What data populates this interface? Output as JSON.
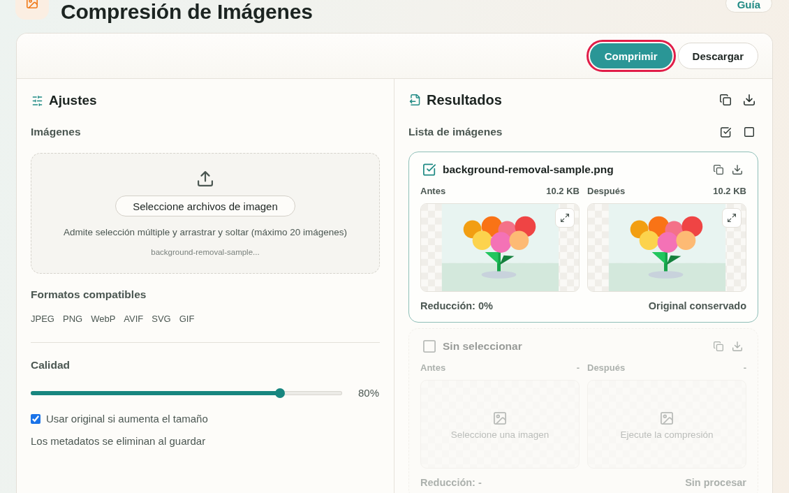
{
  "header": {
    "title": "Compresión de Imágenes",
    "guide_button": "Guía"
  },
  "toolbar": {
    "buttons": [
      {
        "label": "Comprimir",
        "kind": "primary",
        "focused": true
      },
      {
        "label": "Descargar",
        "kind": "secondary",
        "focused": false
      }
    ]
  },
  "settings": {
    "title": "Ajustes",
    "images_label": "Imágenes",
    "dropzone": {
      "button": "Seleccione archivos de imagen",
      "hint": "Admite selección múltiple y arrastrar y soltar (máximo 20 imágenes)",
      "file": "background-removal-sample..."
    },
    "formats_label": "Formatos compatibles",
    "formats": [
      "JPEG",
      "PNG",
      "WebP",
      "AVIF",
      "SVG",
      "GIF"
    ],
    "quality": {
      "label": "Calidad",
      "level": 0.8,
      "reading": "80%"
    },
    "keep_original": {
      "label": "Usar original si aumenta el tamaño",
      "checked": true
    },
    "note": "Los metadatos se eliminan al guardar"
  },
  "results": {
    "title": "Resultados",
    "list_label": "Lista de imágenes",
    "items": [
      {
        "name": "background-removal-sample.png",
        "selected": true,
        "disabled": false,
        "panes": [
          {
            "label": "Antes",
            "size": "10.2 KB",
            "kind": "image"
          },
          {
            "label": "Después",
            "size": "10.2 KB",
            "kind": "image"
          }
        ],
        "reduction": "Reducción: 0%",
        "status": "Original conservado"
      },
      {
        "name": "Sin seleccionar",
        "selected": false,
        "disabled": true,
        "panes": [
          {
            "label": "Antes",
            "size": "-",
            "kind": "empty",
            "message": "Seleccione una imagen"
          },
          {
            "label": "Después",
            "size": "-",
            "kind": "empty",
            "message": "Ejecute la compresión"
          }
        ],
        "reduction": "Reducción: -",
        "status": "Sin procesar"
      }
    ]
  }
}
